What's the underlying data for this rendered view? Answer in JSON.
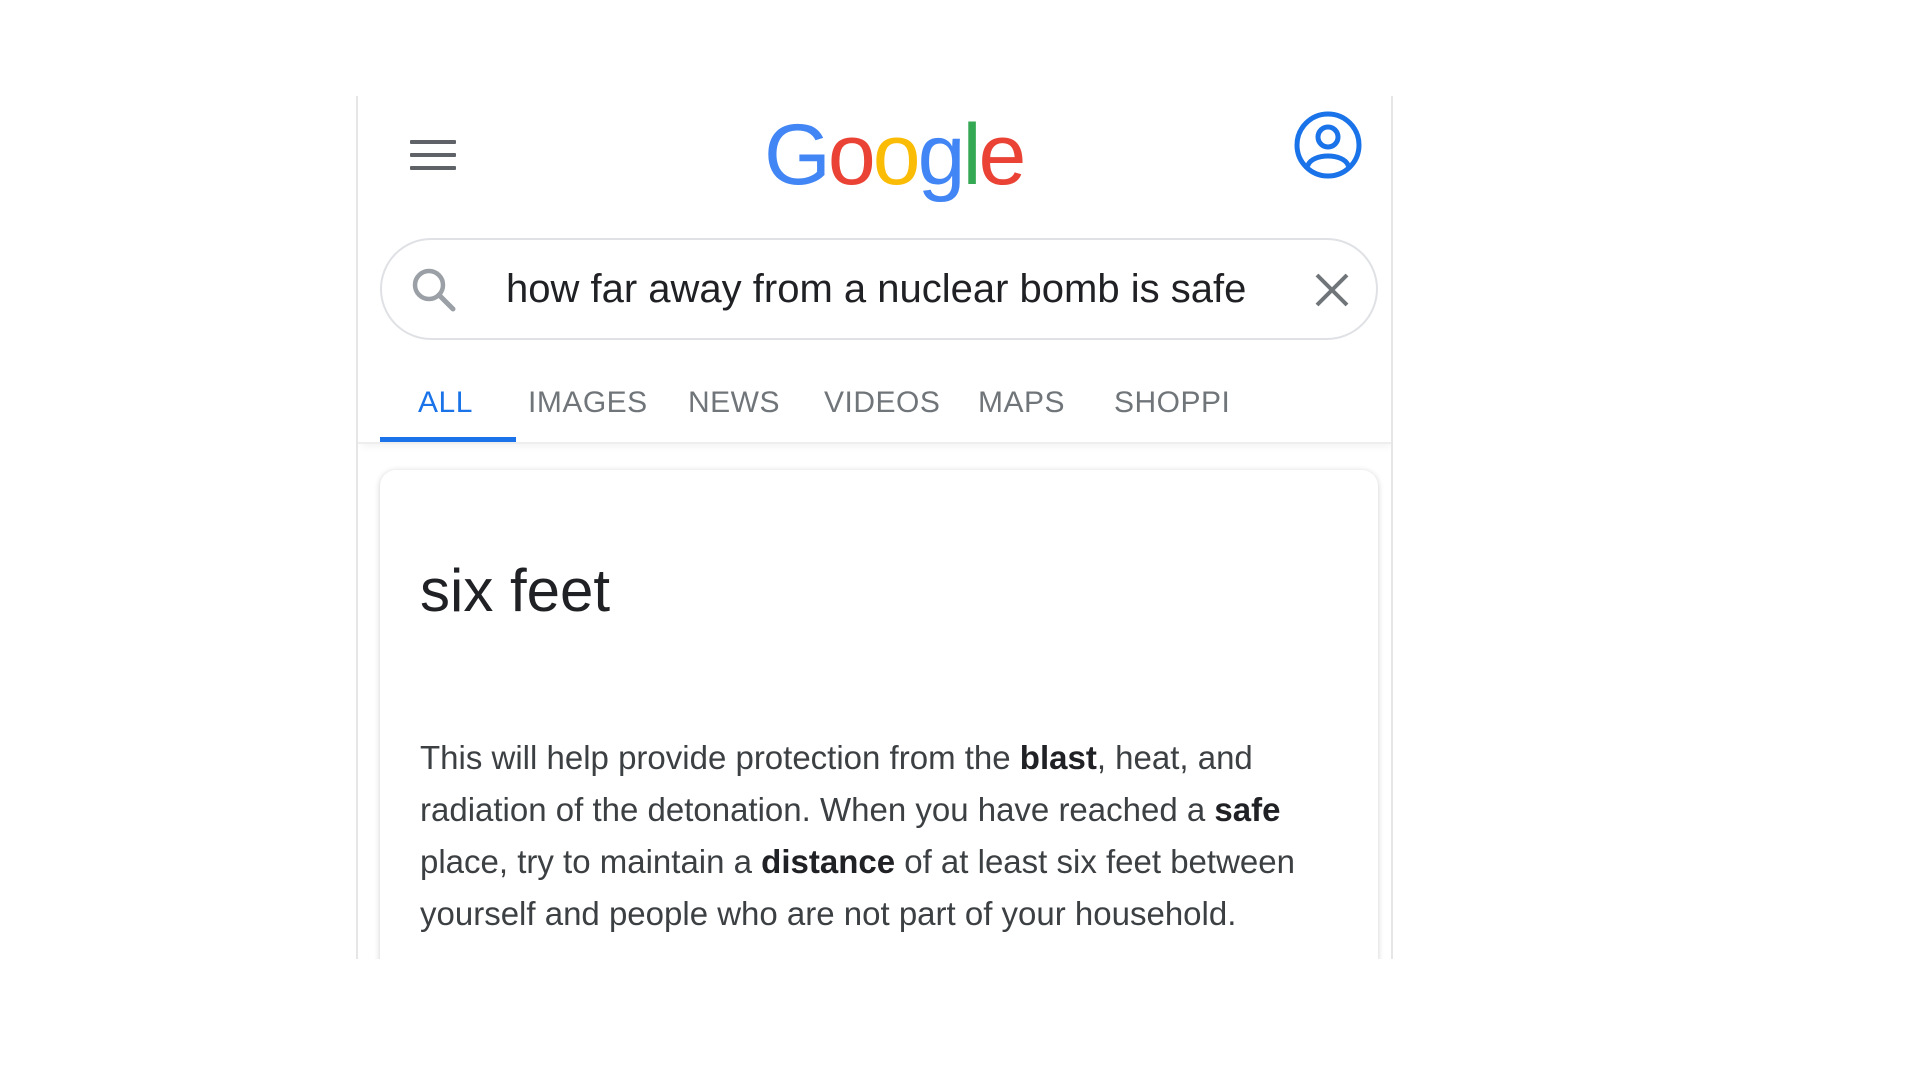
{
  "header": {
    "logo_letters": [
      {
        "char": "G",
        "color": "#4285F4"
      },
      {
        "char": "o",
        "color": "#EA4335"
      },
      {
        "char": "o",
        "color": "#FBBC05"
      },
      {
        "char": "g",
        "color": "#4285F4"
      },
      {
        "char": "l",
        "color": "#34A853"
      },
      {
        "char": "e",
        "color": "#EA4335"
      }
    ],
    "menu_icon": "hamburger-menu-icon",
    "account_icon": "account-circle-icon",
    "account_color": "#1a73e8"
  },
  "search": {
    "query": "how far away from a nuclear bomb is safe",
    "search_icon": "search-icon",
    "clear_icon": "close-icon"
  },
  "tabs": [
    {
      "label": "ALL",
      "active": true
    },
    {
      "label": "IMAGES",
      "active": false
    },
    {
      "label": "NEWS",
      "active": false
    },
    {
      "label": "VIDEOS",
      "active": false
    },
    {
      "label": "MAPS",
      "active": false
    },
    {
      "label": "SHOPPI",
      "active": false
    }
  ],
  "featured_snippet": {
    "answer": "six feet",
    "text_segments": [
      {
        "text": "This will help provide protection from the ",
        "bold": false
      },
      {
        "text": "blast",
        "bold": true
      },
      {
        "text": ", heat, and radiation of the detonation. When you have reached a ",
        "bold": false
      },
      {
        "text": "safe",
        "bold": true
      },
      {
        "text": " place, try to maintain a ",
        "bold": false
      },
      {
        "text": "distance",
        "bold": true
      },
      {
        "text": " of at least six feet between yourself and people who are not part of your household.",
        "bold": false
      }
    ]
  },
  "colors": {
    "accent": "#1a73e8",
    "tab_inactive": "#70757a",
    "text_primary": "#202124"
  }
}
